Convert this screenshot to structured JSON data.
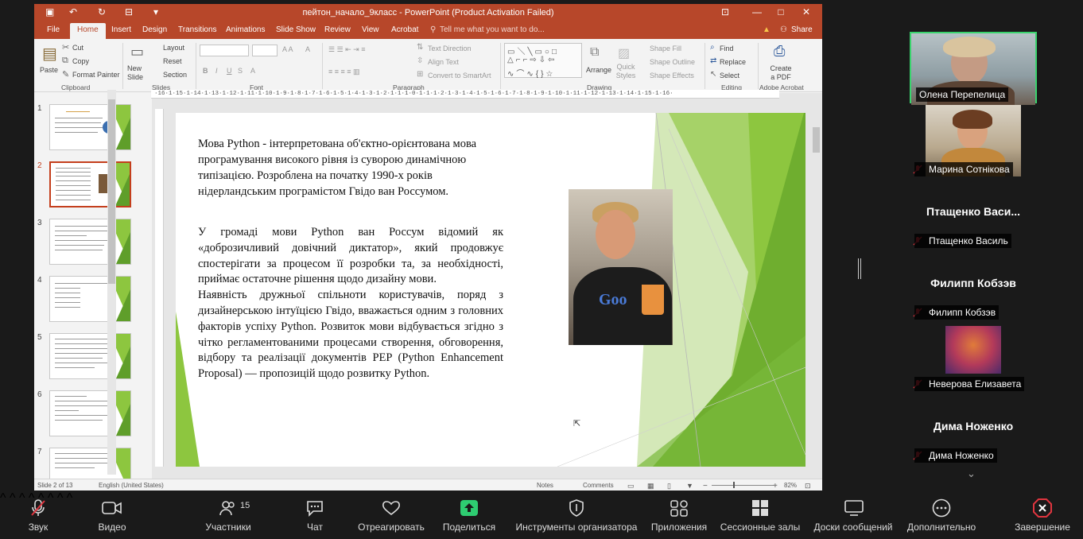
{
  "window": {
    "title": "пейтон_начало_9класс - PowerPoint (Product Activation Failed)",
    "tabs": [
      "File",
      "Home",
      "Insert",
      "Design",
      "Transitions",
      "Animations",
      "Slide Show",
      "Review",
      "View",
      "Acrobat"
    ],
    "active_tab": "Home",
    "tell_me": "Tell me what you want to do...",
    "share": "Share"
  },
  "ribbon": {
    "paste": "Paste",
    "cut": "Cut",
    "copy": "Copy",
    "format_painter": "Format Painter",
    "clipboard": "Clipboard",
    "new_slide": "New Slide",
    "layout": "Layout",
    "reset": "Reset",
    "section": "Section",
    "slides": "Slides",
    "font": "Font",
    "text_direction": "Text Direction",
    "align_text": "Align Text",
    "convert_smartart": "Convert to SmartArt",
    "paragraph": "Paragraph",
    "arrange": "Arrange",
    "quick_styles": "Quick Styles",
    "shape_fill": "Shape Fill",
    "shape_outline": "Shape Outline",
    "shape_effects": "Shape Effects",
    "drawing": "Drawing",
    "find": "Find",
    "replace": "Replace",
    "select": "Select",
    "editing": "Editing",
    "create_pdf": "Create a PDF",
    "adobe_acrobat": "Adobe Acrobat"
  },
  "thumbnails": [
    "1",
    "2",
    "3",
    "4",
    "5",
    "6",
    "7"
  ],
  "ruler": "·16·1·15·1·14·1·13·1·12·1·11·1·10·1·9·1·8·1·7·1·6·1·5·1·4·1·3·1·2·1·1·1·0·1·1·1·2·1·3·1·4·1·5·1·6·1·7·1·8·1·9·1·10·1·11·1·12·1·13·1·14·1·15·1·16·",
  "slide": {
    "para1": "Мова Python - інтерпретована об'єктно-орієнтована мова програмування високого рівня із суворою динамічною типізацією. Розроблена на початку 1990-х років нідерландським програмістом Гвідо ван Россумом.",
    "para2": "У громаді мови Python ван Россум відомий як «доброзичливий довічний диктатор», який продовжує спостерігати за процесом її розробки та, за необхідності, приймає остаточне рішення щодо дизайну мови.",
    "para3": "Наявність дружньої спільноти користувачів, поряд з дизайнерською інтуїцією Гвідо, вважається одним з головних факторів успіху Python. Розвиток мови відбувається згідно з чітко регламентованими процесами створення, обговорення, відбору та реалізації документів PEP (Python Enhancement Proposal) — пропозицій щодо розвитку Python.",
    "photo_logo": "Goo"
  },
  "status": {
    "slide": "Slide 2 of 13",
    "language": "English (United States)",
    "notes": "Notes",
    "comments": "Comments",
    "zoom": "82%"
  },
  "participants": [
    {
      "name": "Олена Перепелица",
      "kind": "video"
    },
    {
      "name": "Марина Сотнікова",
      "kind": "video"
    },
    {
      "name": "Птащенко Василь",
      "big": "Птащенко  Васи...",
      "kind": "name"
    },
    {
      "name": "Филипп Кобзэв",
      "big": "Филипп Кобзэв",
      "kind": "name"
    },
    {
      "name": "Неверова Елизавета",
      "kind": "avatar"
    },
    {
      "name": "Дима Ноженко",
      "big": "Дима Ноженко",
      "kind": "name"
    }
  ],
  "toolbar": {
    "mute": "Звук",
    "video": "Видео",
    "participants": "Участники",
    "participants_count": "15",
    "chat": "Чат",
    "react": "Отреагировать",
    "share": "Поделиться",
    "host_tools": "Инструменты организатора",
    "apps": "Приложения",
    "breakout": "Сессионные залы",
    "whiteboards": "Доски сообщений",
    "more": "Дополнительно",
    "end": "Завершение"
  },
  "colors": {
    "ppt_accent": "#b7472a",
    "slide_green": "#8dc63f",
    "share_green": "#2ecc71",
    "end_red": "#e0353f",
    "active_speaker": "#3ad36d"
  }
}
